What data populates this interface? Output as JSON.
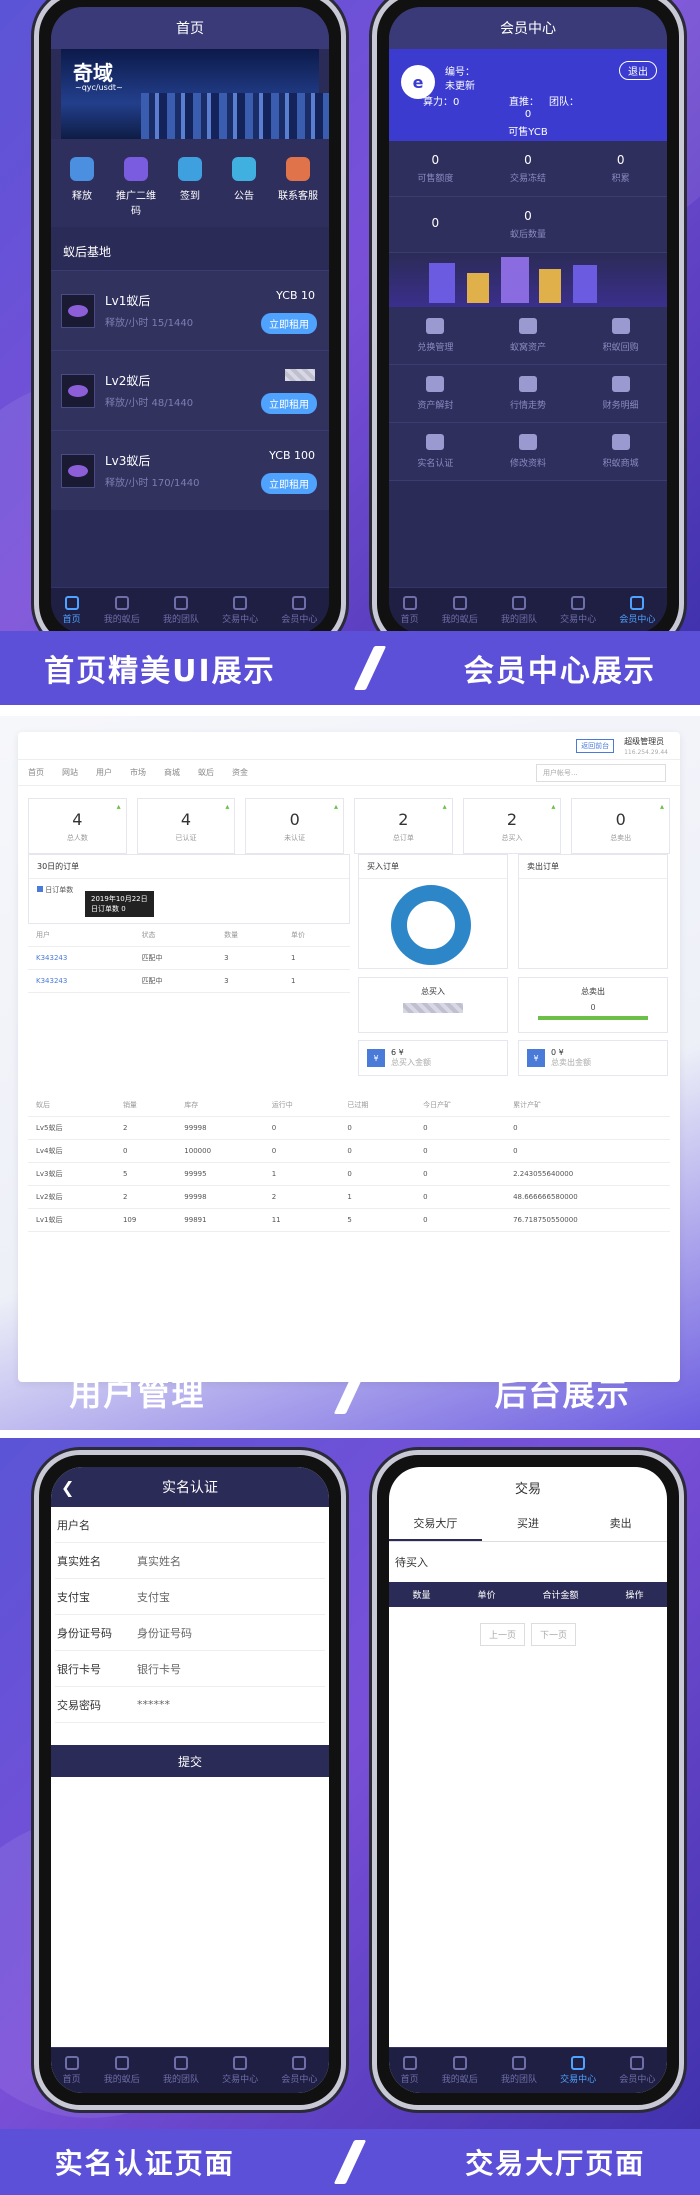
{
  "banners": {
    "top_left": "首页精美UI展示",
    "top_right": "会员中心展示",
    "mid_left": "用户管理",
    "mid_right": "后台展示",
    "bot_left": "实名认证页面",
    "bot_right": "交易大厅页面"
  },
  "home": {
    "title": "首页",
    "logo": "奇域",
    "logo_sub": "~qyc/usdt~",
    "quick": [
      {
        "label": "释放",
        "color": "#4a8fe0"
      },
      {
        "label": "推广二维码",
        "color": "#7a5ce0"
      },
      {
        "label": "签到",
        "color": "#3fa0e0"
      },
      {
        "label": "公告",
        "color": "#3fb0e0"
      },
      {
        "label": "联系客服",
        "color": "#e0734a"
      }
    ],
    "section": "蚁后基地",
    "queens": [
      {
        "name": "Lv1蚁后",
        "sub": "释放/小时 15/1440",
        "price": "YCB 10",
        "btn": "立即租用"
      },
      {
        "name": "Lv2蚁后",
        "sub": "释放/小时 48/1440",
        "price": "",
        "btn": "立即租用"
      },
      {
        "name": "Lv3蚁后",
        "sub": "释放/小时 170/1440",
        "price": "YCB 100",
        "btn": "立即租用"
      }
    ]
  },
  "tabs": [
    {
      "label": "首页"
    },
    {
      "label": "我的蚁后"
    },
    {
      "label": "我的团队"
    },
    {
      "label": "交易中心"
    },
    {
      "label": "会员中心"
    }
  ],
  "member": {
    "title": "会员中心",
    "id_label": "编号：",
    "status": "未更新",
    "power": "算力：0",
    "direct": "直推：",
    "team": "团队：",
    "exit": "退出",
    "ycb_value": "0",
    "ycb_label": "可售YCB",
    "row1": [
      {
        "v": "0",
        "l": "可售额度"
      },
      {
        "v": "0",
        "l": "交易冻结"
      },
      {
        "v": "0",
        "l": "积累"
      }
    ],
    "row2": [
      {
        "v": "0",
        "l": ""
      },
      {
        "v": "0",
        "l": "蚁后数量"
      },
      {
        "v": "",
        "l": ""
      }
    ],
    "menu": [
      {
        "l": "兑换管理"
      },
      {
        "l": "蚁窝资产"
      },
      {
        "l": "积蚁回购"
      },
      {
        "l": "资产解封"
      },
      {
        "l": "行情走势"
      },
      {
        "l": "财务明细"
      },
      {
        "l": "实名认证"
      },
      {
        "l": "修改资料"
      },
      {
        "l": "积蚁商城"
      }
    ]
  },
  "admin": {
    "back": "返回前台",
    "user": "超级管理员",
    "ip": "116.254.29.44",
    "nav": [
      "首页",
      "网站",
      "用户",
      "市场",
      "商城",
      "蚁后",
      "资金"
    ],
    "search_placeholder": "用户帐号...",
    "stats": [
      {
        "v": "4",
        "l": "总人数"
      },
      {
        "v": "4",
        "l": "已认证"
      },
      {
        "v": "0",
        "l": "未认证"
      },
      {
        "v": "2",
        "l": "总订单"
      },
      {
        "v": "2",
        "l": "总买入"
      },
      {
        "v": "0",
        "l": "总卖出"
      }
    ],
    "orders30": "30日的订单",
    "legend": "日订单数",
    "tip_date": "2019年10月22日",
    "tip_label": "日订单数",
    "tip_val": "0",
    "buy_title": "买入订单",
    "sell_title": "卖出订单",
    "users_head": [
      "用户",
      "状态",
      "数量",
      "单价"
    ],
    "users": [
      {
        "u": "K343243",
        "s": "匹配中",
        "n": "3",
        "p": "1"
      },
      {
        "u": "K343243",
        "s": "匹配中",
        "n": "3",
        "p": "1"
      }
    ],
    "total_buy": "总买入",
    "total_sell": "总卖出",
    "total_sell_v": "0",
    "buy_amt": "6 ¥",
    "buy_amt_l": "总买入金额",
    "sell_amt": "0 ¥",
    "sell_amt_l": "总卖出金额",
    "bottom_head": [
      "蚁后",
      "销量",
      "库存",
      "运行中",
      "已过期",
      "今日产矿",
      "累计产矿"
    ],
    "bottom": [
      [
        "Lv5蚁后",
        "2",
        "99998",
        "0",
        "0",
        "0",
        "0"
      ],
      [
        "Lv4蚁后",
        "0",
        "100000",
        "0",
        "0",
        "0",
        "0"
      ],
      [
        "Lv3蚁后",
        "5",
        "99995",
        "1",
        "0",
        "0",
        "2.243055640000"
      ],
      [
        "Lv2蚁后",
        "2",
        "99998",
        "2",
        "1",
        "0",
        "48.666666580000"
      ],
      [
        "Lv1蚁后",
        "109",
        "99891",
        "11",
        "5",
        "0",
        "76.718750550000"
      ]
    ]
  },
  "auth": {
    "title": "实名认证",
    "rows": [
      {
        "l": "用户名",
        "v": ""
      },
      {
        "l": "真实姓名",
        "v": "真实姓名"
      },
      {
        "l": "支付宝",
        "v": "支付宝"
      },
      {
        "l": "身份证号码",
        "v": "身份证号码"
      },
      {
        "l": "银行卡号",
        "v": "银行卡号"
      },
      {
        "l": "交易密码",
        "v": "******"
      }
    ],
    "submit": "提交"
  },
  "trade": {
    "title": "交易",
    "tabs": [
      "交易大厅",
      "买进",
      "卖出"
    ],
    "section": "待买入",
    "cols": [
      "数量",
      "单价",
      "合计金额",
      "操作"
    ],
    "prev": "上一页",
    "next": "下一页"
  }
}
